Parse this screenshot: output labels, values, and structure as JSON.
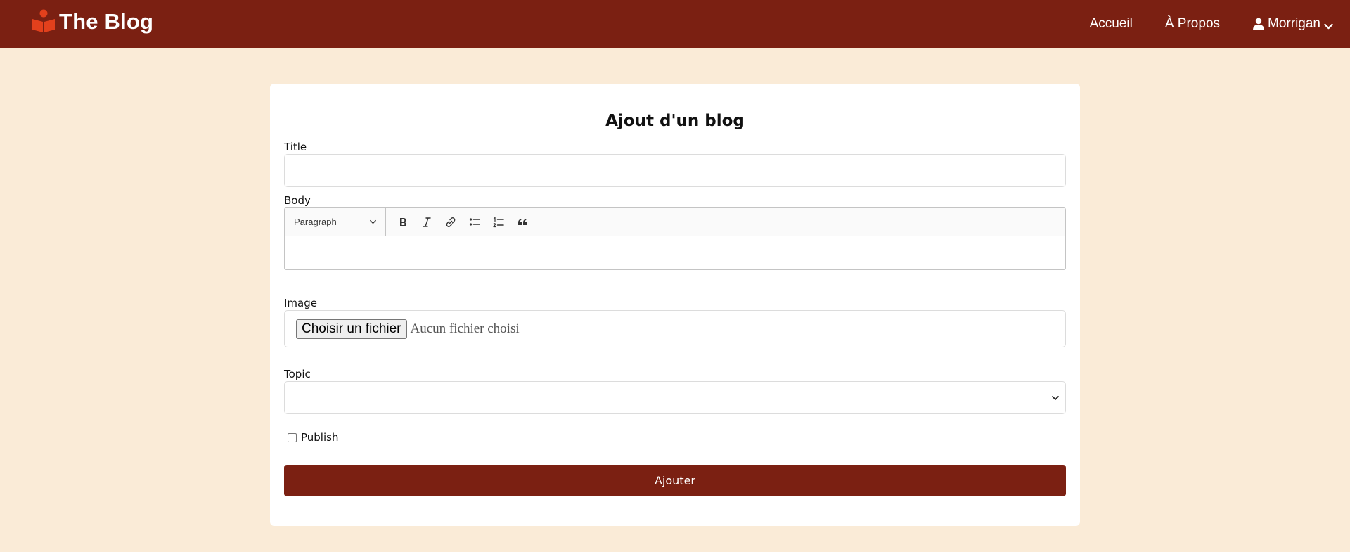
{
  "navbar": {
    "brand": "The Blog",
    "links": [
      "Accueil",
      "À Propos"
    ],
    "user": "Morrigan",
    "brand_color": "#7b2012",
    "logo_color": "#e2401c"
  },
  "form": {
    "title": "Ajout d'un blog",
    "title_label": "Title",
    "body_label": "Body",
    "heading_select": "Paragraph",
    "image_label": "Image",
    "file_button": "Choisir un fichier",
    "file_status": "Aucun fichier choisi",
    "topic_label": "Topic",
    "publish_label": "Publish",
    "submit_label": "Ajouter"
  },
  "colors": {
    "page_background": "#faebd7",
    "card_background": "#ffffff"
  }
}
